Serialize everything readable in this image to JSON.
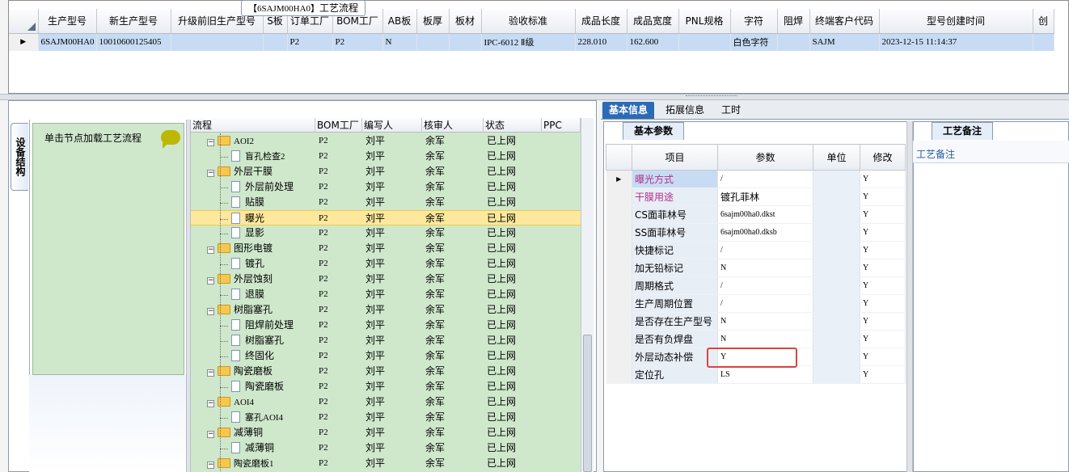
{
  "top_grid": {
    "headers": [
      "生产型号",
      "新生产型号",
      "升级前旧生产型号",
      "S板",
      "订单工厂",
      "BOM工厂",
      "AB板",
      "板厚",
      "板材",
      "验收标准",
      "成品长度",
      "成品宽度",
      "PNL规格",
      "字符",
      "阻焊",
      "终端客户代码",
      "型号创建时间",
      "创"
    ],
    "row": [
      "6SAJM00HA0",
      "10010600125405",
      "",
      "",
      "P2",
      "P2",
      "N",
      "",
      "",
      "IPC-6012 Ⅱ级",
      "228.010",
      "162.600",
      "",
      "白色字符",
      "",
      "SAJM",
      "2023-12-15 11:14:37",
      ""
    ]
  },
  "process": {
    "title_code": "【6SAJM00HA0】",
    "title_text": "工艺流程",
    "vertical_tab": "设备结构",
    "node_hint": "单击节点加载工艺流程",
    "headers": [
      "流程",
      "BOM工厂",
      "编写人",
      "核审人",
      "状态",
      "PPC"
    ],
    "rows": [
      {
        "level": 0,
        "name": "AOI2",
        "bom": "P2",
        "writer": "刘平",
        "reviewer": "余军",
        "status": "已上网"
      },
      {
        "level": 1,
        "name": "盲孔检查2",
        "bom": "P2",
        "writer": "刘平",
        "reviewer": "余军",
        "status": "已上网"
      },
      {
        "level": 0,
        "name": "外层干膜",
        "bom": "P2",
        "writer": "刘平",
        "reviewer": "余军",
        "status": "已上网"
      },
      {
        "level": 1,
        "name": "外层前处理",
        "bom": "P2",
        "writer": "刘平",
        "reviewer": "余军",
        "status": "已上网"
      },
      {
        "level": 1,
        "name": "贴膜",
        "bom": "P2",
        "writer": "刘平",
        "reviewer": "余军",
        "status": "已上网"
      },
      {
        "level": 1,
        "name": "曝光",
        "bom": "P2",
        "writer": "刘平",
        "reviewer": "余军",
        "status": "已上网",
        "selected": true
      },
      {
        "level": 1,
        "name": "显影",
        "bom": "P2",
        "writer": "刘平",
        "reviewer": "余军",
        "status": "已上网"
      },
      {
        "level": 0,
        "name": "图形电镀",
        "bom": "P2",
        "writer": "刘平",
        "reviewer": "余军",
        "status": "已上网"
      },
      {
        "level": 1,
        "name": "镀孔",
        "bom": "P2",
        "writer": "刘平",
        "reviewer": "余军",
        "status": "已上网"
      },
      {
        "level": 0,
        "name": "外层蚀刻",
        "bom": "P2",
        "writer": "刘平",
        "reviewer": "余军",
        "status": "已上网"
      },
      {
        "level": 1,
        "name": "退膜",
        "bom": "P2",
        "writer": "刘平",
        "reviewer": "余军",
        "status": "已上网"
      },
      {
        "level": 0,
        "name": "树脂塞孔",
        "bom": "P2",
        "writer": "刘平",
        "reviewer": "余军",
        "status": "已上网"
      },
      {
        "level": 1,
        "name": "阻焊前处理",
        "bom": "P2",
        "writer": "刘平",
        "reviewer": "余军",
        "status": "已上网"
      },
      {
        "level": 1,
        "name": "树脂塞孔",
        "bom": "P2",
        "writer": "刘平",
        "reviewer": "余军",
        "status": "已上网"
      },
      {
        "level": 1,
        "name": "终固化",
        "bom": "P2",
        "writer": "刘平",
        "reviewer": "余军",
        "status": "已上网"
      },
      {
        "level": 0,
        "name": "陶瓷磨板",
        "bom": "P2",
        "writer": "刘平",
        "reviewer": "余军",
        "status": "已上网"
      },
      {
        "level": 1,
        "name": "陶瓷磨板",
        "bom": "P2",
        "writer": "刘平",
        "reviewer": "余军",
        "status": "已上网"
      },
      {
        "level": 0,
        "name": "AOI4",
        "bom": "P2",
        "writer": "刘平",
        "reviewer": "余军",
        "status": "已上网"
      },
      {
        "level": 1,
        "name": "塞孔AOI4",
        "bom": "P2",
        "writer": "刘平",
        "reviewer": "余军",
        "status": "已上网"
      },
      {
        "level": 0,
        "name": "减薄铜",
        "bom": "P2",
        "writer": "刘平",
        "reviewer": "余军",
        "status": "已上网"
      },
      {
        "level": 1,
        "name": "减薄铜",
        "bom": "P2",
        "writer": "刘平",
        "reviewer": "余军",
        "status": "已上网"
      },
      {
        "level": 0,
        "name": "陶瓷磨板1",
        "bom": "P2",
        "writer": "刘平",
        "reviewer": "余军",
        "status": "已上网"
      }
    ]
  },
  "tabs": [
    "基本信息",
    "拓展信息",
    "工时"
  ],
  "basic": {
    "subtab": "基本参数",
    "headers": [
      "项目",
      "参数",
      "单位",
      "修改"
    ],
    "rows": [
      {
        "item": "曝光方式",
        "value": "/",
        "unit": "",
        "mod": "Y",
        "link": true
      },
      {
        "item": "干膜用途",
        "value": "镀孔菲林",
        "unit": "",
        "mod": "Y",
        "link": true
      },
      {
        "item": "CS面菲林号",
        "value": "6sajm00ha0.dkst",
        "unit": "",
        "mod": "Y"
      },
      {
        "item": "SS面菲林号",
        "value": "6sajm00ha0.dksb",
        "unit": "",
        "mod": "Y"
      },
      {
        "item": "快捷标记",
        "value": "/",
        "unit": "",
        "mod": "Y"
      },
      {
        "item": "加无铅标记",
        "value": "N",
        "unit": "",
        "mod": "Y"
      },
      {
        "item": "周期格式",
        "value": "/",
        "unit": "",
        "mod": "Y"
      },
      {
        "item": "生产周期位置",
        "value": "/",
        "unit": "",
        "mod": "Y"
      },
      {
        "item": "是否存在生产型号",
        "value": "N",
        "unit": "",
        "mod": "Y"
      },
      {
        "item": "是否有负焊盘",
        "value": "N",
        "unit": "",
        "mod": "Y"
      },
      {
        "item": "外层动态补偿",
        "value": "Y",
        "unit": "",
        "mod": "Y"
      },
      {
        "item": "定位孔",
        "value": "LS",
        "unit": "",
        "mod": "Y"
      }
    ]
  },
  "notes": {
    "subtab": "工艺备注",
    "label": "工艺备注"
  },
  "colors": {
    "accent": "#2b6ab5",
    "tree_bg": "#cfe8cc",
    "selected_row": "#fde89c",
    "highlight_box": "#d8453f",
    "link_text": "#b0308a"
  }
}
